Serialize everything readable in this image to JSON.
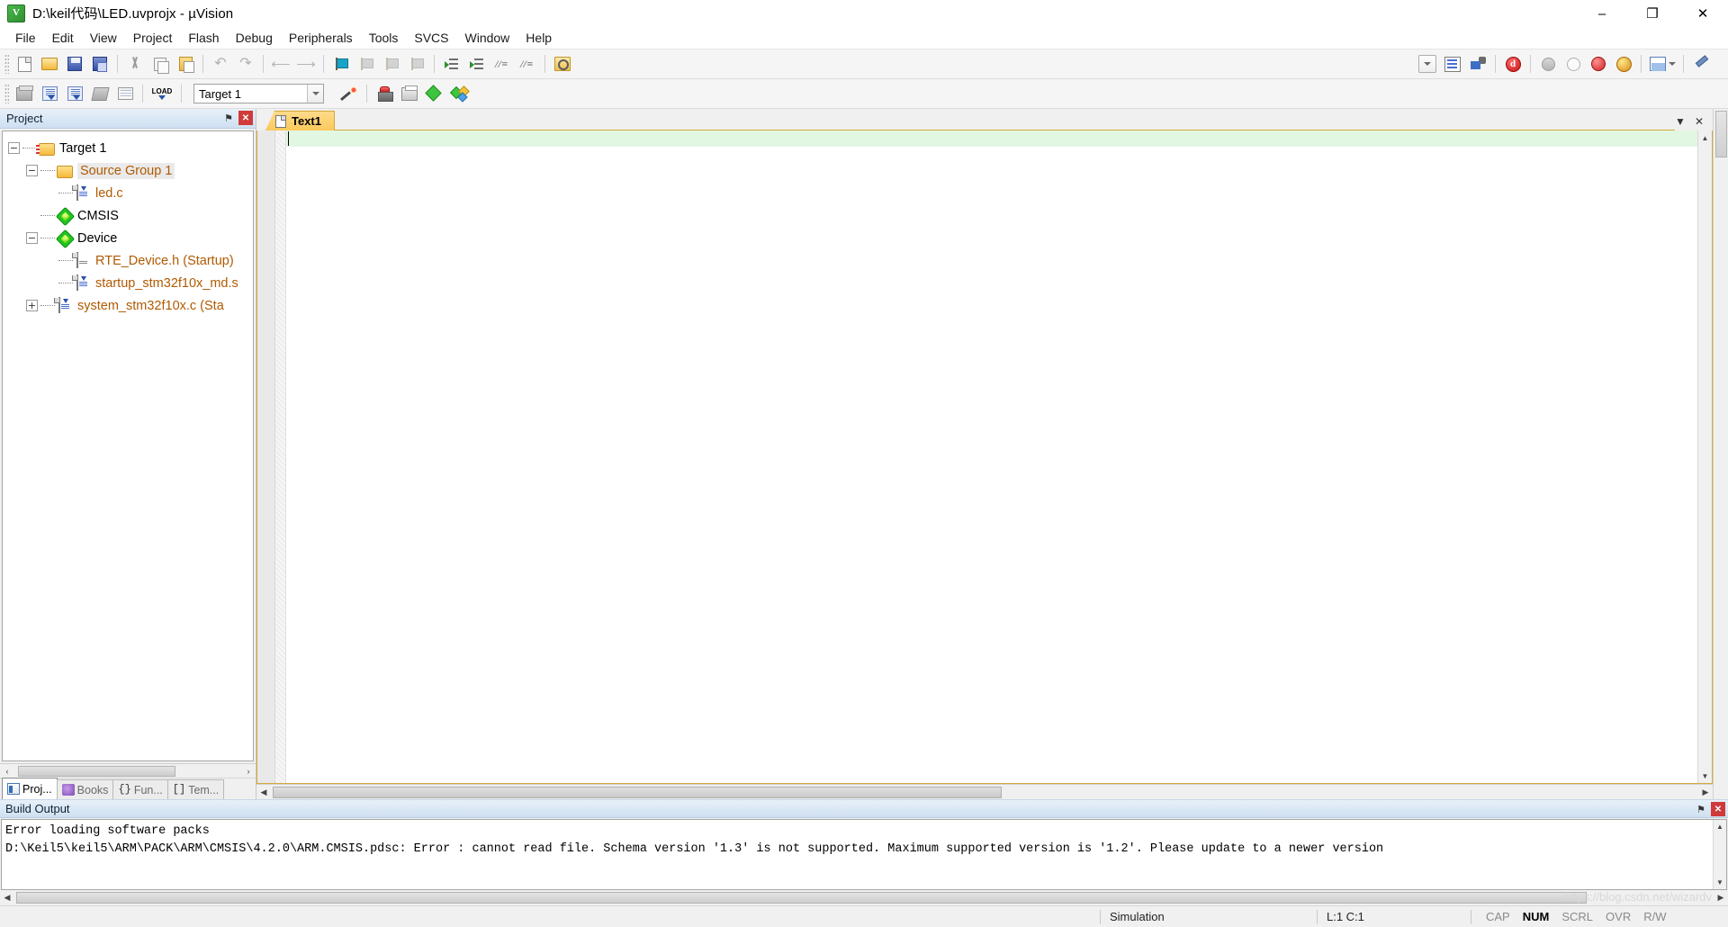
{
  "window": {
    "title": "D:\\keil代码\\LED.uvprojx - µVision",
    "app_icon": "uvision-logo-icon",
    "minimize": "–",
    "maximize": "❐",
    "close": "✕"
  },
  "menubar": {
    "items": [
      {
        "label": "File",
        "name": "menu-file"
      },
      {
        "label": "Edit",
        "name": "menu-edit"
      },
      {
        "label": "View",
        "name": "menu-view"
      },
      {
        "label": "Project",
        "name": "menu-project"
      },
      {
        "label": "Flash",
        "name": "menu-flash"
      },
      {
        "label": "Debug",
        "name": "menu-debug"
      },
      {
        "label": "Peripherals",
        "name": "menu-peripherals"
      },
      {
        "label": "Tools",
        "name": "menu-tools"
      },
      {
        "label": "SVCS",
        "name": "menu-svcs"
      },
      {
        "label": "Window",
        "name": "menu-window"
      },
      {
        "label": "Help",
        "name": "menu-help"
      }
    ]
  },
  "toolbar_main": {
    "icons": [
      "new-file-icon",
      "open-file-icon",
      "save-icon",
      "save-all-icon",
      "cut-icon",
      "copy-icon",
      "paste-icon",
      "undo-icon",
      "redo-icon",
      "navigate-back-icon",
      "navigate-forward-icon",
      "insert-bookmark-icon",
      "prev-bookmark-icon",
      "next-bookmark-icon",
      "clear-bookmarks-icon",
      "indent-icon",
      "outdent-icon",
      "comment-icon",
      "uncomment-icon",
      "find-in-files-icon",
      "find-combo-dropdown-icon",
      "find-icon",
      "bookmark-window-icon",
      "start-debug-icon",
      "insert-breakpoint-icon",
      "kill-breakpoint-icon",
      "disable-breakpoint-icon",
      "kill-all-breakpoints-icon",
      "manage-windows-icon",
      "configuration-wizard-icon"
    ]
  },
  "toolbar_build": {
    "icons": [
      "translate-icon",
      "build-icon",
      "rebuild-icon",
      "batch-build-icon",
      "stop-build-icon",
      "download-icon"
    ],
    "target_select": {
      "value": "Target 1",
      "name": "target-select"
    },
    "right_icons": [
      "select-target-box-icon",
      "target-options-icon",
      "manage-project-items-icon",
      "packs-installer-icon",
      "manage-runtime-env-icon",
      "software-packs-icon"
    ]
  },
  "project_panel": {
    "caption": "Project",
    "pin_glyph": "⚑",
    "close_glyph": "✕",
    "tree": [
      {
        "label": "Target 1",
        "icon": "project-target-folder-icon",
        "depth": 0,
        "expander": "−",
        "selected": false
      },
      {
        "label": "Source Group 1",
        "icon": "folder-icon",
        "depth": 1,
        "expander": "−",
        "selected": true
      },
      {
        "label": "led.c",
        "icon": "c-source-file-icon",
        "depth": 2,
        "expander": "",
        "selected": false
      },
      {
        "label": "CMSIS",
        "icon": "green-diamond-icon",
        "depth": 1,
        "expander": "",
        "selected": false
      },
      {
        "label": "Device",
        "icon": "green-diamond-icon",
        "depth": 1,
        "expander": "−",
        "selected": false
      },
      {
        "label": "RTE_Device.h (Startup)",
        "icon": "header-file-icon",
        "depth": 2,
        "expander": "",
        "selected": false
      },
      {
        "label": "startup_stm32f10x_md.s",
        "icon": "asm-source-file-icon",
        "depth": 2,
        "expander": "",
        "selected": false
      },
      {
        "label": "system_stm32f10x.c (Sta",
        "icon": "c-source-file-icon",
        "depth": 2,
        "expander": "+",
        "selected": false
      }
    ],
    "tabs": [
      {
        "label": "Proj...",
        "icon": "project-icon",
        "active": true
      },
      {
        "label": "Books",
        "icon": "books-icon",
        "active": false
      },
      {
        "label": "Fun...",
        "icon": "functions-icon",
        "active": false,
        "prefix": "{}"
      },
      {
        "label": "Tem...",
        "icon": "templates-icon",
        "active": false,
        "prefix": "[]"
      }
    ],
    "scroll_left_glyph": "‹",
    "scroll_right_glyph": "›"
  },
  "editor": {
    "tabs": [
      {
        "label": "Text1",
        "icon": "text-file-icon",
        "active": true
      }
    ],
    "tab_menu_glyph": "▼",
    "tab_close_glyph": "✕",
    "content_lines": [
      ""
    ],
    "cursor_line": 1,
    "cursor_column": 1
  },
  "build_output": {
    "caption": "Build Output",
    "pin_glyph": "⚑",
    "close_glyph": "✕",
    "lines": [
      "Error loading software packs",
      "D:\\Keil5\\keil5\\ARM\\PACK\\ARM\\CMSIS\\4.2.0\\ARM.CMSIS.pdsc: Error : cannot read file. Schema version '1.3' is not supported. Maximum supported version is '1.2'. Please update to a newer version"
    ]
  },
  "statusbar": {
    "simulation": "Simulation",
    "position": "L:1 C:1",
    "indicators": [
      {
        "label": "CAP",
        "on": false
      },
      {
        "label": "NUM",
        "on": true
      },
      {
        "label": "SCRL",
        "on": false
      },
      {
        "label": "OVR",
        "on": false
      },
      {
        "label": "R/W",
        "on": false
      }
    ]
  },
  "watermark": "https://blog.csdn.net/wizardv",
  "colors": {
    "title_bar": "#ffffff",
    "toolbar_bg": "#f5f5f5",
    "panel_caption": "#cfe0f1",
    "tree_node_text": "#b05a00",
    "editor_tab": "#fbc95b",
    "current_line": "#e2f7e2",
    "accent_green": "#22c422"
  }
}
